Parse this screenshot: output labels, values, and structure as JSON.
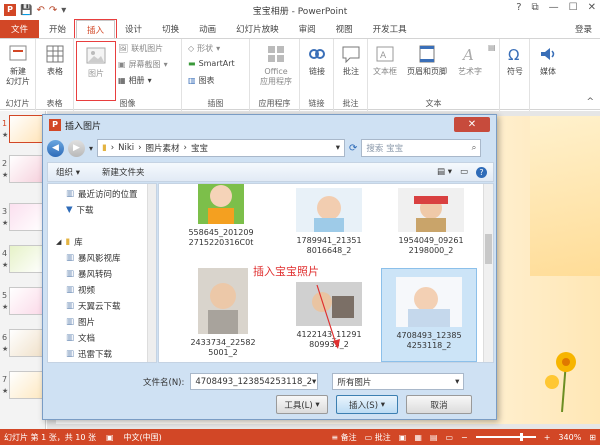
{
  "window": {
    "title": "宝宝相册 - PowerPoint",
    "login": "登录"
  },
  "tabs": [
    "文件",
    "开始",
    "插入",
    "设计",
    "切换",
    "动画",
    "幻灯片放映",
    "审阅",
    "视图",
    "开发工具"
  ],
  "ribbon": {
    "new_slide": "新建\n幻灯片",
    "table": "表格",
    "picture": "图片",
    "online_picture": "联机图片",
    "screenshot": "屏幕截图",
    "album": "相册",
    "shapes": "形状",
    "smartart": "SmartArt",
    "chart": "图表",
    "office_apps": "Office\n应用程序",
    "link": "链接",
    "comment": "批注",
    "textbox": "文本框",
    "header_footer": "页眉和页脚",
    "wordart": "艺术字",
    "symbol": "符号",
    "media": "媒体",
    "groups": {
      "slides": "幻灯片",
      "tables": "表格",
      "images": "图像",
      "illustrations": "插图",
      "apps": "应用程序",
      "links": "链接",
      "comments": "批注",
      "text": "文本"
    }
  },
  "slides": [
    {
      "num": "1"
    },
    {
      "num": "2"
    },
    {
      "num": "3"
    },
    {
      "num": "4"
    },
    {
      "num": "5"
    },
    {
      "num": "6"
    },
    {
      "num": "7"
    }
  ],
  "dialog": {
    "title": "插入图片",
    "path": [
      "Niki",
      "图片素材",
      "宝宝"
    ],
    "search_placeholder": "搜索 宝宝",
    "organize": "组织 ▾",
    "new_folder": "新建文件夹",
    "nav_items": [
      {
        "label": "最近访问的位置"
      },
      {
        "label": "下载"
      },
      {
        "label": "库"
      },
      {
        "label": "暴风影视库"
      },
      {
        "label": "暴风转码"
      },
      {
        "label": "视频"
      },
      {
        "label": "天翼云下载"
      },
      {
        "label": "图片"
      },
      {
        "label": "文档"
      },
      {
        "label": "迅雷下载"
      }
    ],
    "files": [
      {
        "name1": "558645_201209",
        "name2": "2715220316C0t"
      },
      {
        "name1": "1789941_21351",
        "name2": "8016648_2"
      },
      {
        "name1": "1954049_09261",
        "name2": "2198000_2"
      },
      {
        "name1": "2433734_22582",
        "name2": "5001_2"
      },
      {
        "name1": "4122143_11291",
        "name2": "809935_2"
      },
      {
        "name1": "4708493_12385",
        "name2": "4253118_2"
      }
    ],
    "annotation": "插入宝宝照片",
    "filename_label": "文件名(N):",
    "filename_value": "4708493_123854253118_2",
    "filter": "所有图片",
    "tools": "工具(L)",
    "insert": "插入(S)",
    "cancel": "取消"
  },
  "statusbar": {
    "slide_info": "幻灯片 第 1 张，共 10 张",
    "lang": "中文(中国)",
    "notes": "备注",
    "comments": "批注",
    "zoom": "340%"
  },
  "colors": {
    "accent": "#d24726",
    "selection": "#cce4f7"
  }
}
